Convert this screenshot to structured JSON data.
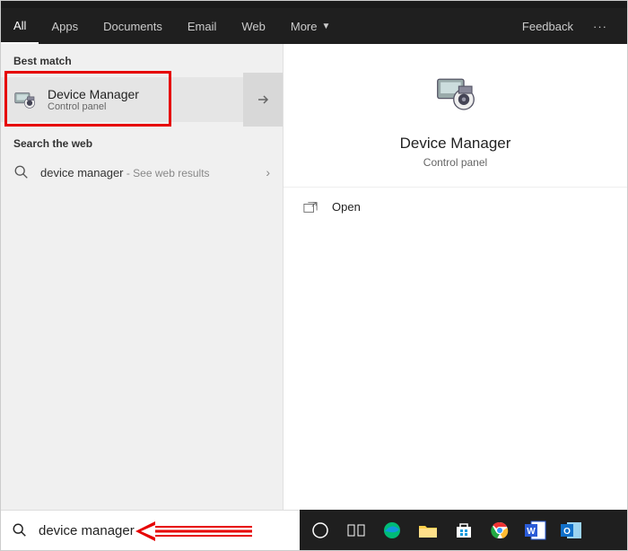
{
  "tabs": {
    "all": "All",
    "apps": "Apps",
    "documents": "Documents",
    "email": "Email",
    "web": "Web",
    "more": "More"
  },
  "feedback": "Feedback",
  "sections": {
    "best_match": "Best match",
    "search_web": "Search the web"
  },
  "best_match": {
    "title": "Device Manager",
    "subtitle": "Control panel"
  },
  "web_result": {
    "query": "device manager",
    "suffix": " - See web results"
  },
  "detail": {
    "title": "Device Manager",
    "subtitle": "Control panel",
    "open": "Open"
  },
  "search": {
    "value": "device manager"
  }
}
